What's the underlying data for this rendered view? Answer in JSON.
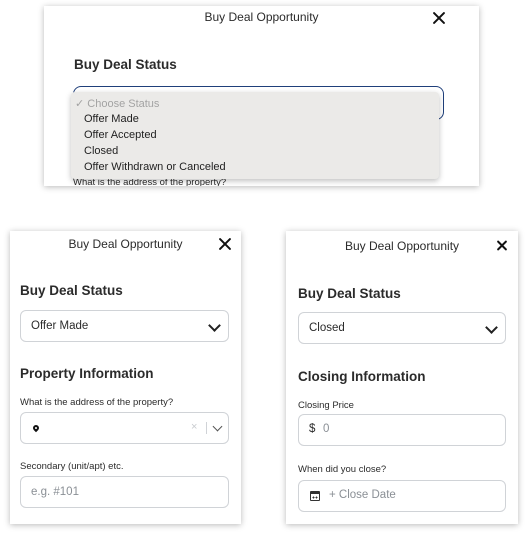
{
  "top_panel": {
    "title": "Buy Deal Opportunity",
    "section_heading": "Buy Deal Status",
    "dropdown_options": [
      "✓ Choose Status",
      "Offer Made",
      "Offer Accepted",
      "Closed",
      "Offer Withdrawn or Canceled"
    ],
    "behind_label": "What is the address of the property?"
  },
  "left_panel": {
    "title": "Buy Deal Opportunity",
    "status_heading": "Buy Deal Status",
    "status_value": "Offer Made",
    "property_heading": "Property Information",
    "address_label": "What is the address of the property?",
    "clear_symbol": "×",
    "secondary_label": "Secondary (unit/apt) etc.",
    "secondary_placeholder": "e.g. #101"
  },
  "right_panel": {
    "title": "Buy Deal Opportunity",
    "status_heading": "Buy Deal Status",
    "status_value": "Closed",
    "closing_heading": "Closing Information",
    "closing_price_label": "Closing Price",
    "currency_symbol": "$",
    "closing_price_placeholder": "0",
    "close_date_label": "When did you close?",
    "close_date_placeholder": "+ Close Date"
  },
  "icons": [
    "close-icon",
    "chevron-down-icon",
    "map-pin-icon",
    "clear-icon",
    "calendar-icon"
  ],
  "colors": {
    "focus_border": "#1f3f7a",
    "dropdown_bg": "#ebeae8",
    "field_border": "#d0d3d7"
  }
}
